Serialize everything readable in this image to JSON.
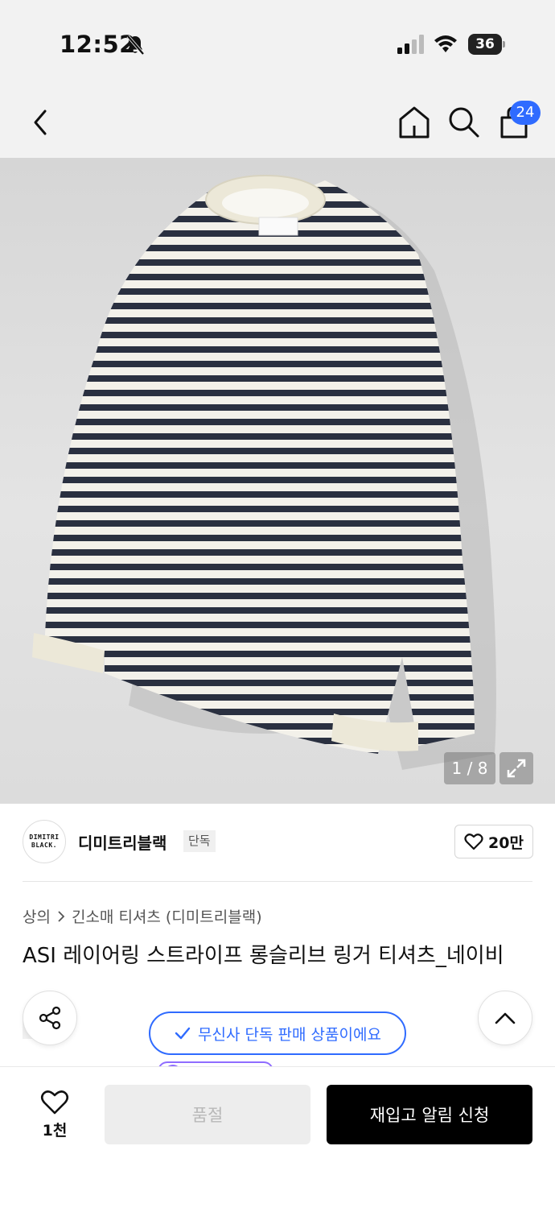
{
  "status_bar": {
    "time": "12:52",
    "battery": "36",
    "icons": [
      "bell-slash-icon",
      "signal-icon",
      "wifi-icon",
      "battery-icon"
    ]
  },
  "header": {
    "icons": [
      "chevron-left-icon",
      "home-icon",
      "search-icon",
      "shopping-bag-icon"
    ],
    "cart_badge": "24"
  },
  "gallery": {
    "counter": "1 / 8",
    "expand_icon": "expand-icon",
    "image_subject": "striped-long-sleeve-tshirt"
  },
  "brand": {
    "logo_lines": [
      "DIMITRI",
      "BLACK."
    ],
    "name": "디미트리블랙",
    "exclusive_tag": "단독",
    "like_count": "20만"
  },
  "product": {
    "breadcrumb": {
      "category": "상의",
      "subcategory": "긴소매 티셔츠 (디미트리블랙)"
    },
    "title": "ASI 레이어링 스트라이프 롱슬리브 링거 티셔츠_네이비",
    "tag": "단독"
  },
  "floating": {
    "exclusive_notice": "무신사 단독 판매 상품이에요",
    "share_icon": "share-icon",
    "scroll_top_icon": "chevron-up-icon"
  },
  "bottom_bar": {
    "wish_count": "1천",
    "soldout_label": "품절",
    "restock_label": "재입고 알림 신청"
  },
  "colors": {
    "accent": "#2f6bff",
    "badge": "#2f6bff",
    "primary_button": "#000000",
    "disabled_button": "#ededed"
  }
}
